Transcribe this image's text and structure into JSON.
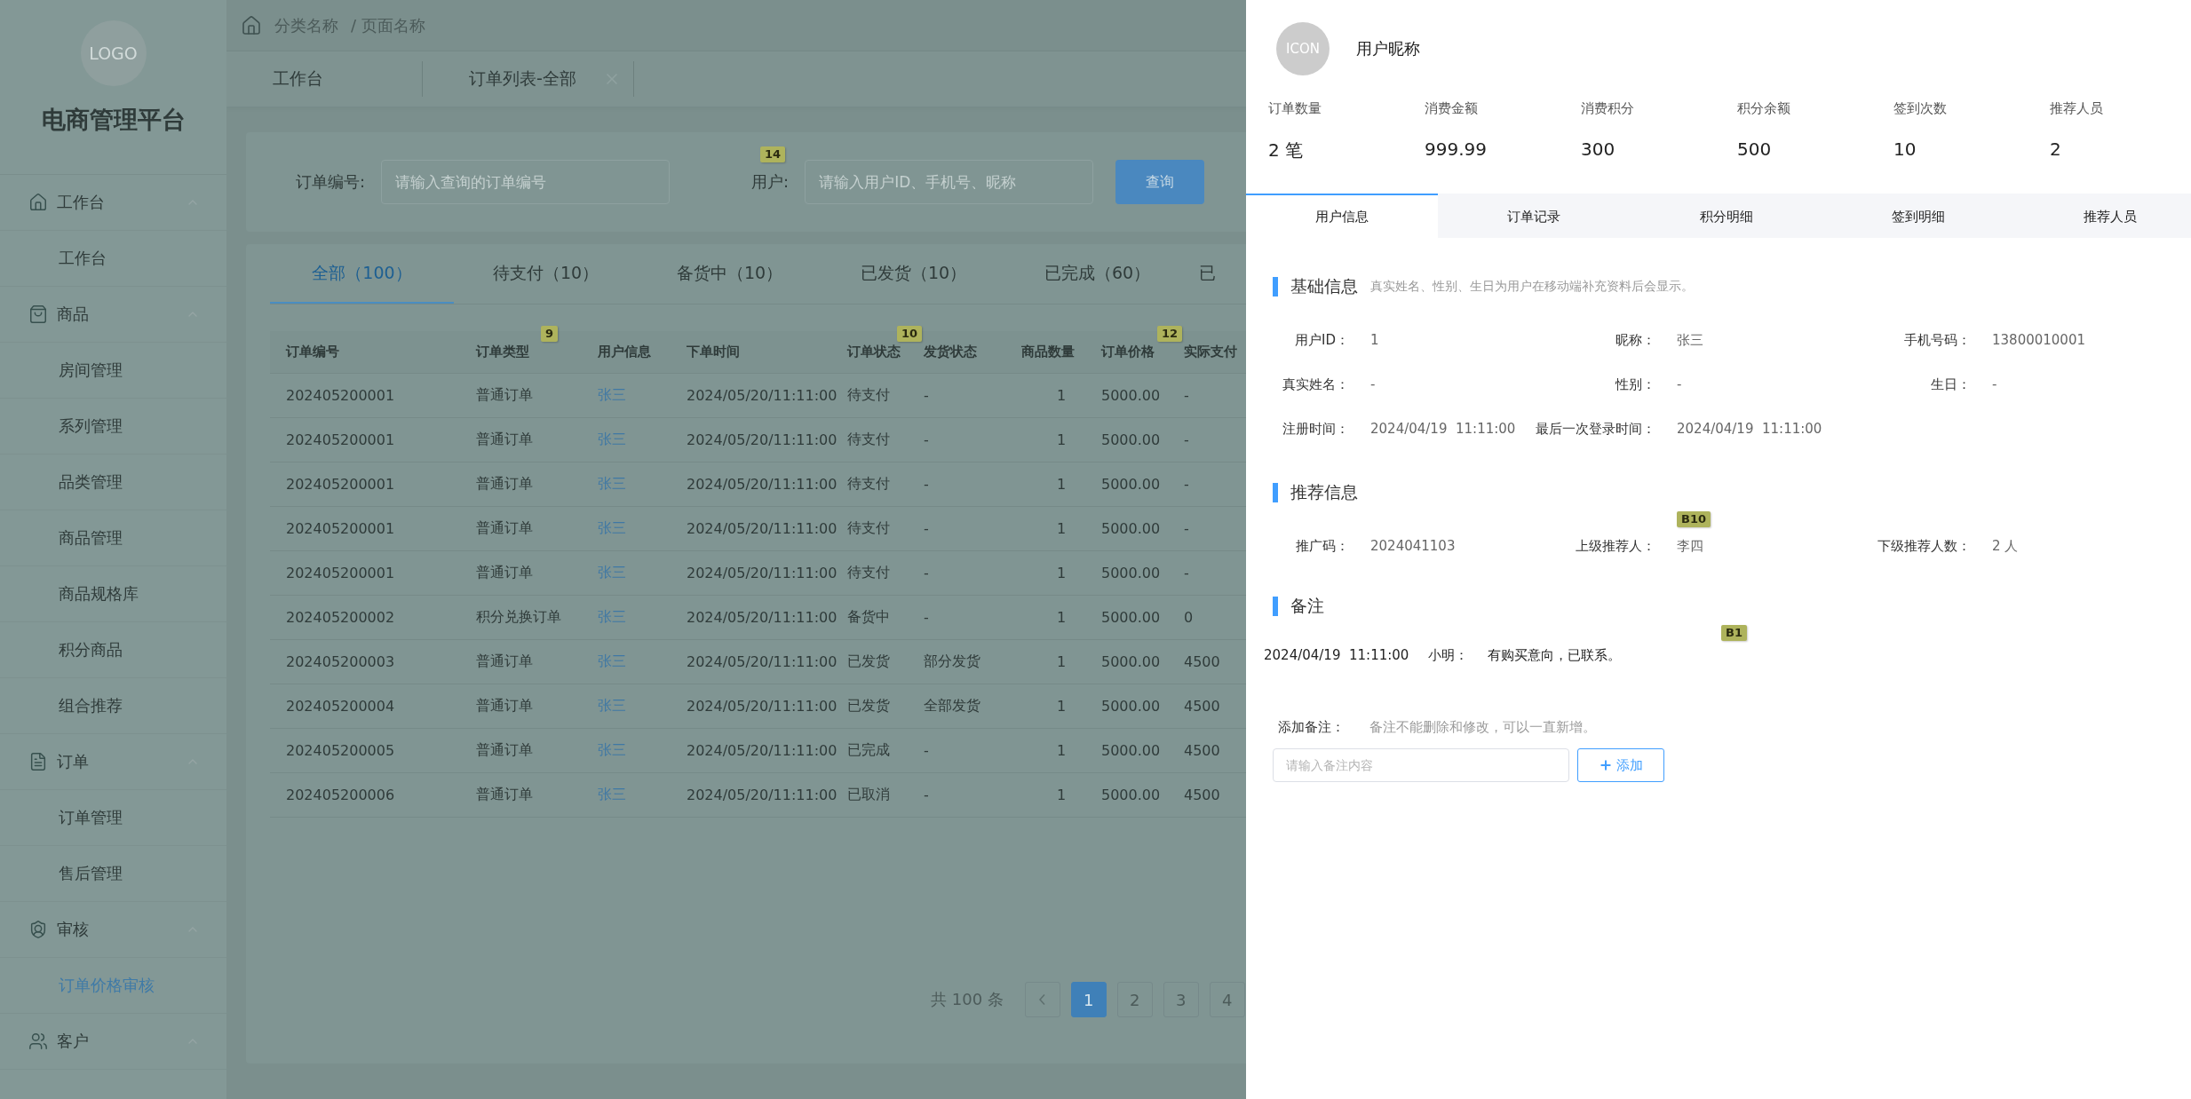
{
  "sidebar": {
    "logo": "LOGO",
    "title": "电商管理平台",
    "menu": [
      {
        "label": "工作台",
        "expanded": true,
        "children": [
          {
            "label": "工作台",
            "selected": false
          }
        ]
      },
      {
        "label": "商品",
        "expanded": true,
        "children": [
          {
            "label": "房间管理",
            "selected": false
          },
          {
            "label": "系列管理",
            "selected": false
          },
          {
            "label": "品类管理",
            "selected": false
          },
          {
            "label": "商品管理",
            "selected": false
          },
          {
            "label": "商品规格库",
            "selected": false
          },
          {
            "label": "积分商品",
            "selected": false
          },
          {
            "label": "组合推荐",
            "selected": false
          }
        ]
      },
      {
        "label": "订单",
        "expanded": true,
        "children": [
          {
            "label": "订单管理",
            "selected": false
          },
          {
            "label": "售后管理",
            "selected": false
          }
        ]
      },
      {
        "label": "审核",
        "expanded": true,
        "children": [
          {
            "label": "订单价格审核",
            "selected": true
          }
        ]
      },
      {
        "label": "客户",
        "expanded": true
      }
    ]
  },
  "breadcrumb": {
    "items": [
      "分类名称",
      "页面名称"
    ],
    "separator": "/"
  },
  "page_tabs": [
    {
      "label": "工作台",
      "closable": false
    },
    {
      "label": "订单列表-全部",
      "closable": true
    }
  ],
  "search": {
    "fields": [
      {
        "label": "订单编号:",
        "placeholder": "请输入查询的订单编号"
      },
      {
        "label": "用户:",
        "placeholder": "请输入用户ID、手机号、昵称",
        "annotation": "14"
      }
    ],
    "button": "查询"
  },
  "status_tabs": [
    {
      "label": "全部（100）",
      "selected": true
    },
    {
      "label": "待支付（10）",
      "selected": false
    },
    {
      "label": "备货中（10）",
      "selected": false
    },
    {
      "label": "已发货（10）",
      "selected": false
    },
    {
      "label": "已完成（60）",
      "selected": false
    },
    {
      "label": "已",
      "selected": false
    }
  ],
  "table": {
    "columns": [
      {
        "label": "订单编号",
        "kind": "text"
      },
      {
        "label": "订单类型",
        "kind": "text",
        "annotation": "9"
      },
      {
        "label": "用户信息",
        "kind": "link"
      },
      {
        "label": "下单时间",
        "kind": "text"
      },
      {
        "label": "订单状态",
        "kind": "text",
        "annotation": "10"
      },
      {
        "label": "发货状态",
        "kind": "text"
      },
      {
        "label": "商品数量",
        "kind": "center"
      },
      {
        "label": "订单价格",
        "kind": "text",
        "annotation": "12"
      },
      {
        "label": "实际支付",
        "kind": "text"
      }
    ],
    "rows": [
      [
        "202405200001",
        "普通订单",
        "张三",
        "2024/05/20/11:11:00",
        "待支付",
        "-",
        "1",
        "5000.00",
        "-"
      ],
      [
        "202405200001",
        "普通订单",
        "张三",
        "2024/05/20/11:11:00",
        "待支付",
        "-",
        "1",
        "5000.00",
        "-"
      ],
      [
        "202405200001",
        "普通订单",
        "张三",
        "2024/05/20/11:11:00",
        "待支付",
        "-",
        "1",
        "5000.00",
        "-"
      ],
      [
        "202405200001",
        "普通订单",
        "张三",
        "2024/05/20/11:11:00",
        "待支付",
        "-",
        "1",
        "5000.00",
        "-"
      ],
      [
        "202405200001",
        "普通订单",
        "张三",
        "2024/05/20/11:11:00",
        "待支付",
        "-",
        "1",
        "5000.00",
        "-"
      ],
      [
        "202405200002",
        "积分兑换订单",
        "张三",
        "2024/05/20/11:11:00",
        "备货中",
        "-",
        "1",
        "5000.00",
        "0"
      ],
      [
        "202405200003",
        "普通订单",
        "张三",
        "2024/05/20/11:11:00",
        "已发货",
        "部分发货",
        "1",
        "5000.00",
        "4500"
      ],
      [
        "202405200004",
        "普通订单",
        "张三",
        "2024/05/20/11:11:00",
        "已发货",
        "全部发货",
        "1",
        "5000.00",
        "4500"
      ],
      [
        "202405200005",
        "普通订单",
        "张三",
        "2024/05/20/11:11:00",
        "已完成",
        "-",
        "1",
        "5000.00",
        "4500"
      ],
      [
        "202405200006",
        "普通订单",
        "张三",
        "2024/05/20/11:11:00",
        "已取消",
        "-",
        "1",
        "5000.00",
        "4500"
      ]
    ]
  },
  "pagination": {
    "total": "共 100 条",
    "pages": [
      {
        "label": "1",
        "selected": true
      },
      {
        "label": "2",
        "selected": false
      },
      {
        "label": "3",
        "selected": false
      },
      {
        "label": "4",
        "selected": false
      }
    ]
  },
  "drawer": {
    "avatar": "ICON",
    "nickname": "用户昵称",
    "stats": [
      {
        "label": "订单数量",
        "value": "2 笔"
      },
      {
        "label": "消费金额",
        "value": "999.99"
      },
      {
        "label": "消费积分",
        "value": "300"
      },
      {
        "label": "积分余额",
        "value": "500"
      },
      {
        "label": "签到次数",
        "value": "10"
      },
      {
        "label": "推荐人员",
        "value": "2"
      }
    ],
    "tabs": [
      {
        "label": "用户信息",
        "selected": true
      },
      {
        "label": "订单记录",
        "selected": false
      },
      {
        "label": "积分明细",
        "selected": false
      },
      {
        "label": "签到明细",
        "selected": false
      },
      {
        "label": "推荐人员",
        "selected": false
      }
    ],
    "basic": {
      "title": "基础信息",
      "hint": "真实姓名、性别、生日为用户在移动端补充资料后会显示。",
      "rows": [
        [
          {
            "label": "用户ID：",
            "value": "1"
          },
          {
            "label": "昵称：",
            "value": "张三"
          },
          {
            "label": "手机号码：",
            "value": "13800010001"
          }
        ],
        [
          {
            "label": "真实姓名：",
            "value": "-"
          },
          {
            "label": "性别：",
            "value": "-"
          },
          {
            "label": "生日：",
            "value": "-"
          }
        ],
        [
          {
            "label": "注册时间：",
            "value": "2024/04/19  11:11:00"
          },
          {
            "label": "最后一次登录时间：",
            "value": "2024/04/19  11:11:00"
          }
        ]
      ]
    },
    "referral": {
      "title": "推荐信息",
      "rows": [
        [
          {
            "label": "推广码：",
            "value": "2024041103"
          },
          {
            "label": "上级推荐人：",
            "value": "李四",
            "annotation": "B10"
          },
          {
            "label": "下级推荐人数：",
            "value": "2 人"
          }
        ]
      ]
    },
    "notes": {
      "title": "备注",
      "entries": [
        {
          "time": "2024/04/19  11:11:00",
          "author": "小明：",
          "text": "有购买意向，已联系。",
          "annotation": "B1"
        }
      ],
      "add_label": "添加备注：",
      "add_hint": "备注不能删除和修改，可以一直新增。",
      "placeholder": "请输入备注内容",
      "button": "添加"
    }
  }
}
